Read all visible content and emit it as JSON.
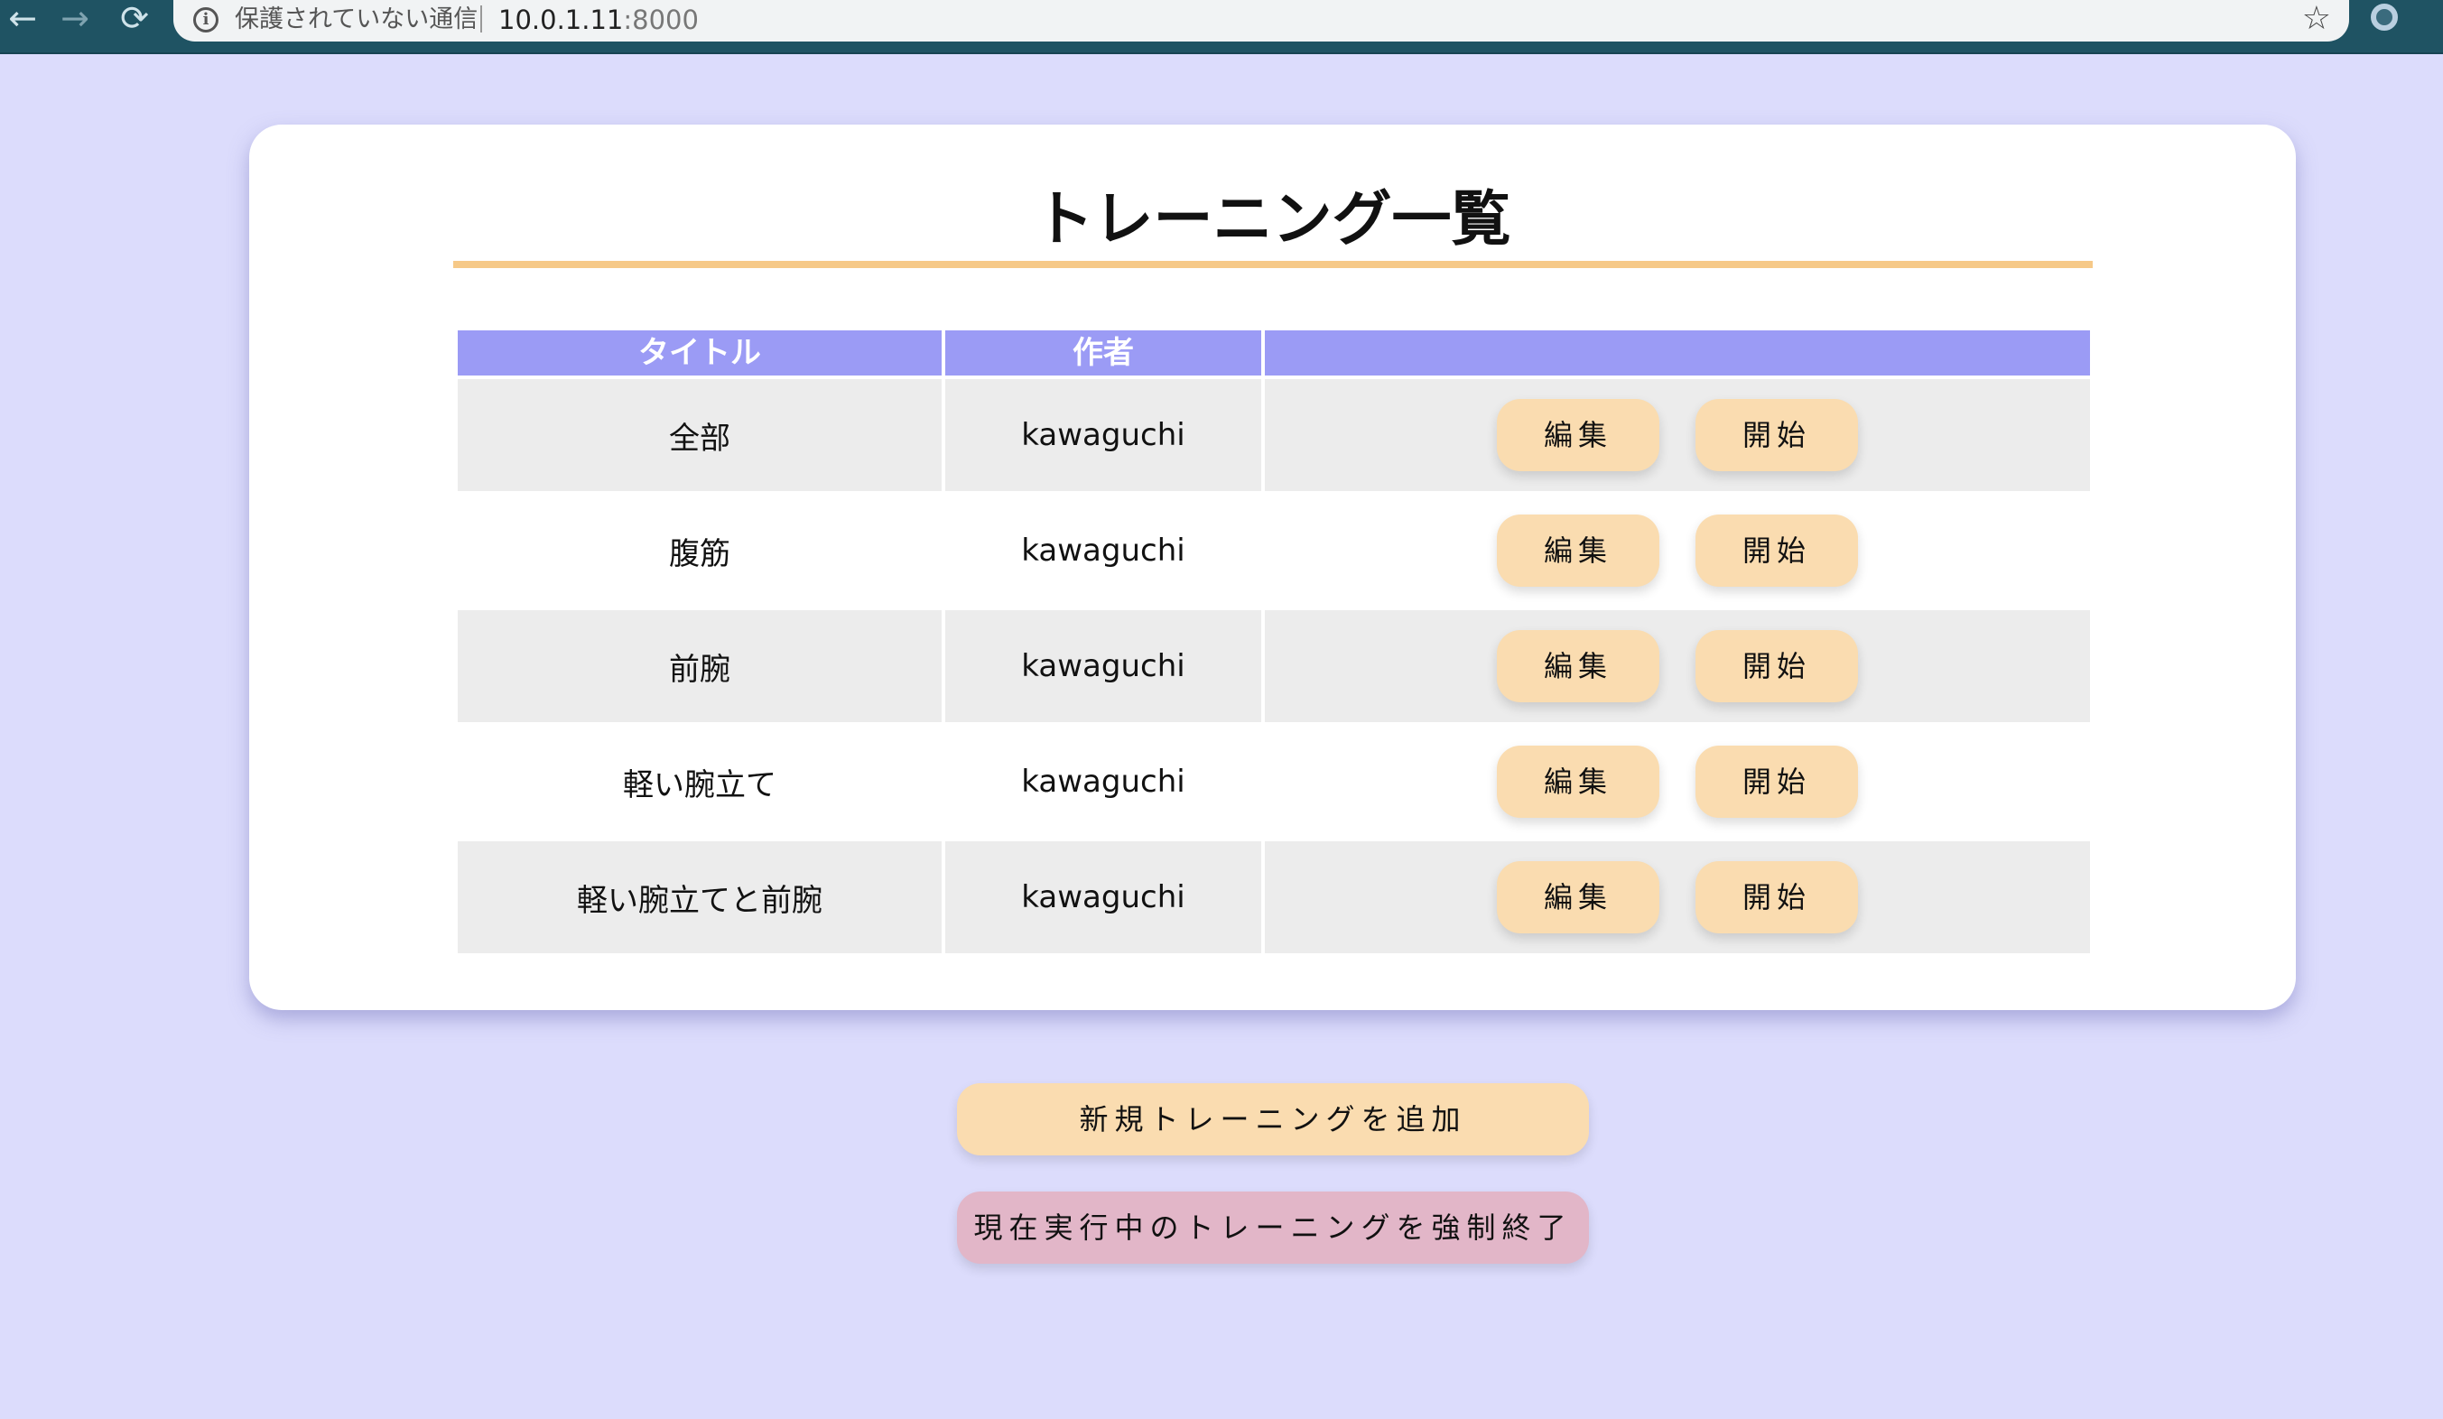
{
  "browser": {
    "back_icon": "←",
    "forward_icon": "→",
    "reload_icon": "⟳",
    "info_icon": "i",
    "security_text": "保護されていない通信",
    "url_host": "10.0.1.11",
    "url_port": ":8000",
    "star_icon": "☆"
  },
  "page": {
    "title": "トレーニング一覧"
  },
  "table": {
    "headers": [
      "タイトル",
      "作者",
      ""
    ],
    "rows": [
      {
        "title": "全部",
        "author": "kawaguchi",
        "edit": "編集",
        "start": "開始"
      },
      {
        "title": "腹筋",
        "author": "kawaguchi",
        "edit": "編集",
        "start": "開始"
      },
      {
        "title": "前腕",
        "author": "kawaguchi",
        "edit": "編集",
        "start": "開始"
      },
      {
        "title": "軽い腕立て",
        "author": "kawaguchi",
        "edit": "編集",
        "start": "開始"
      },
      {
        "title": "軽い腕立てと前腕",
        "author": "kawaguchi",
        "edit": "編集",
        "start": "開始"
      }
    ]
  },
  "actions": {
    "add_label": "新規トレーニングを追加",
    "stop_label": "現在実行中のトレーニングを強制終了"
  },
  "colors": {
    "background": "#dcdcfc",
    "header": "#9b9bf5",
    "accent_button": "#fadcb0",
    "danger_button": "#e2b6c8",
    "underline": "#f6c988"
  }
}
